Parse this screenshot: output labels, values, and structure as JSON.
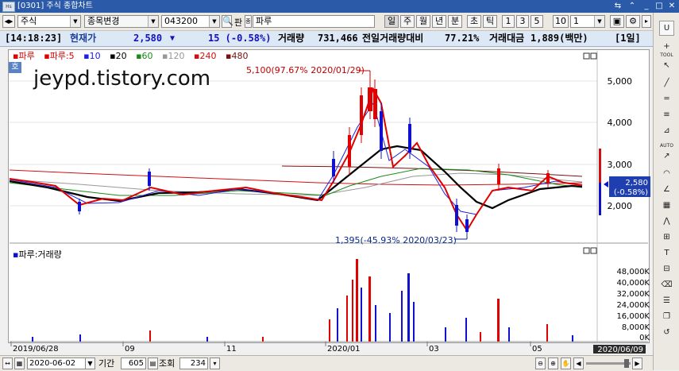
{
  "window": {
    "title": "[0301] 주식 종합차트"
  },
  "toolbar": {
    "market": "주식",
    "change_button": "종목변경",
    "code": "043200",
    "pan_label": "판",
    "stock_name": "파루",
    "period_buttons": [
      "일",
      "주",
      "월",
      "년",
      "분",
      "초",
      "틱"
    ],
    "interval_buttons": [
      "1",
      "3",
      "5",
      "10"
    ],
    "interval_value": "1"
  },
  "pricebar": {
    "time": "[14:18:23]",
    "current_label": "현재가",
    "price": "2,580",
    "change_arrow": "▼",
    "change": "15 (-0.58%)",
    "volume_label": "거래량",
    "volume": "731,466",
    "prev_vol_label": "전일거래량대비",
    "prev_vol_ratio": "77.21%",
    "amount_label": "거래대금",
    "amount": "1,889(백만)",
    "period_badge": "[1일]"
  },
  "legend": {
    "name": "파루",
    "ma_label": "파루:5",
    "items": [
      "10",
      "20",
      "60",
      "120",
      "240",
      "480"
    ]
  },
  "colors": {
    "ma5": "#e00000",
    "ma10": "#2020e0",
    "ma20": "#000000",
    "ma60": "#1a8a1a",
    "ma120": "#999999",
    "ma240": "#d01010",
    "ma480": "#7a1010",
    "up": "#e00000",
    "down": "#1010d0",
    "titlebar": "#2b5aa8"
  },
  "chart": {
    "watermark": "jeypd.tistory.com",
    "label_ho": "호",
    "high_annotation": "5,100(97.67% 2020/01/29)",
    "low_annotation": "1,395(-45.93% 2020/03/23)",
    "price_axis": [
      "5,000",
      "4,000",
      "3,000",
      "2,000"
    ],
    "current_price_tag": "2,580",
    "current_change_tag": "(-0.58%)",
    "volume_title": "파루:거래량",
    "volume_axis": [
      "48,000K",
      "40,000K",
      "32,000K",
      "24,000K",
      "16,000K",
      "8,000K",
      "0K"
    ],
    "date_axis": [
      "2019/06/28",
      "09",
      "11",
      "2020/01",
      "03",
      "05",
      "2020/06/09"
    ]
  },
  "bottombar": {
    "date": "2020-06-02",
    "period_label": "기간",
    "period_value": "605",
    "lookup_label": "조회",
    "lookup_value": "234"
  },
  "sidebar": {
    "top_button": "U",
    "labels": [
      "TOOL",
      "AUTO"
    ]
  }
}
